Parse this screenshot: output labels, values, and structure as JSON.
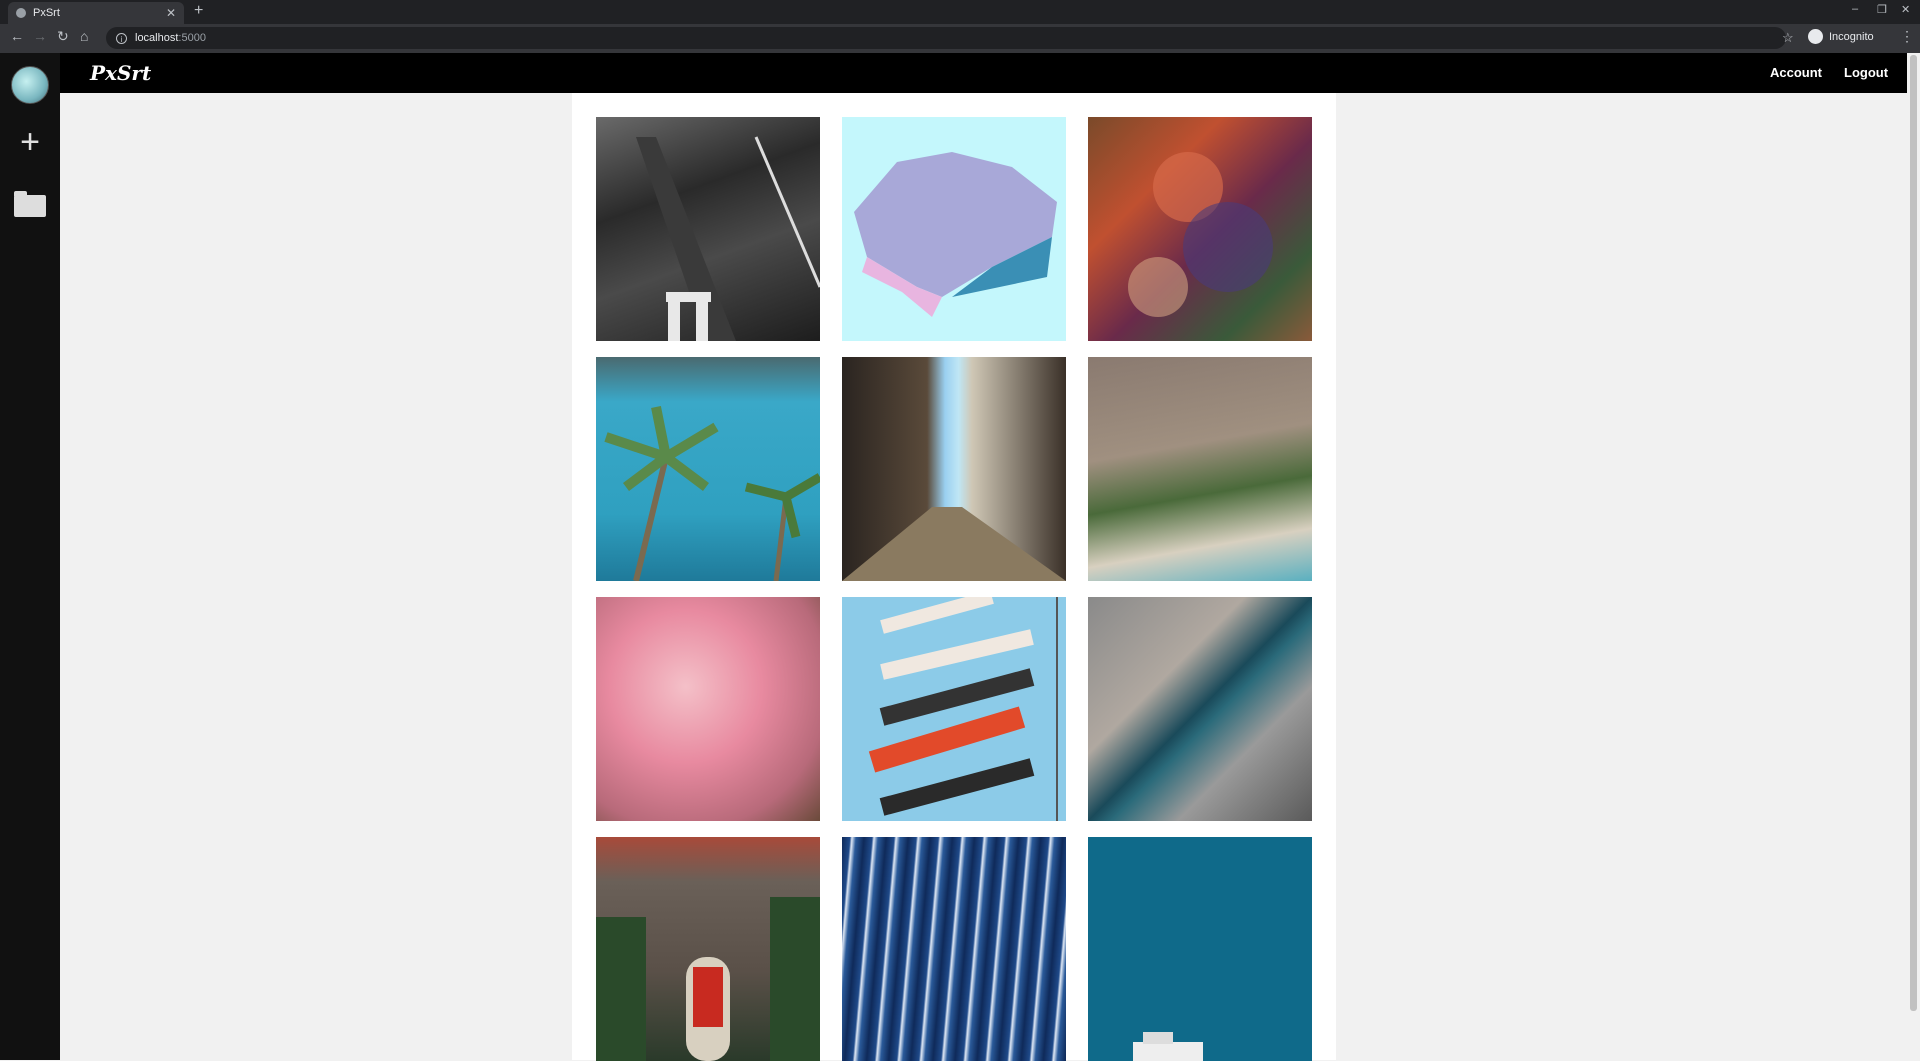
{
  "browser": {
    "tab_title": "PxSrt",
    "url_host": "localhost",
    "url_port": ":5000",
    "profile_label": "Incognito"
  },
  "app": {
    "logo": "PxSrt",
    "nav": {
      "account": "Account",
      "logout": "Logout"
    },
    "sidebar": [
      "avatar",
      "plus-icon",
      "folder-icon"
    ]
  },
  "gallery": {
    "photos": [
      "street-crosswalk-bw",
      "isometric-cubes-pastel",
      "patterned-fabric-boat",
      "palm-trees-ocean",
      "narrow-alley-sea-view",
      "aerial-beach-hillside",
      "cherry-blossom-tree",
      "koinobori-carp-streamers",
      "aerial-city-canal",
      "red-door-brick-building",
      "blue-water-streaks",
      "teal-sky-rooftop"
    ]
  }
}
